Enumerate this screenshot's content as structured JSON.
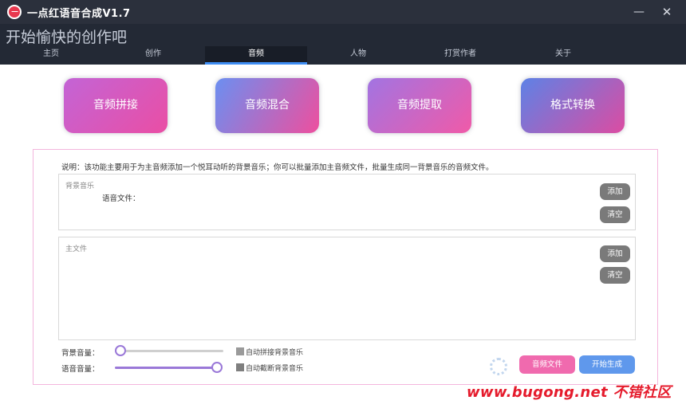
{
  "window": {
    "title": "一点红语音合成V1.7",
    "minimize_glyph": "—",
    "close_glyph": "✕"
  },
  "header": {
    "slogan": "开始愉快的创作吧",
    "tabs": [
      {
        "label": "主页"
      },
      {
        "label": "创作"
      },
      {
        "label": "音频",
        "active": true
      },
      {
        "label": "人物"
      },
      {
        "label": "打赏作者"
      },
      {
        "label": "关于"
      }
    ]
  },
  "features": [
    {
      "label": "音频拼接"
    },
    {
      "label": "音频混合"
    },
    {
      "label": "音频提取"
    },
    {
      "label": "格式转换"
    }
  ],
  "panel": {
    "description": "说明：该功能主要用于为主音频添加一个悦耳动听的背景音乐；你可以批量添加主音频文件，批量生成同一背景音乐的音频文件。",
    "bgm_box": {
      "label": "背景音乐",
      "voice_file_label": "语音文件：",
      "add_label": "添加",
      "clear_label": "清空"
    },
    "main_box": {
      "label": "主文件",
      "add_label": "添加",
      "clear_label": "清空"
    },
    "bg_volume_label": "背景音量：",
    "bg_volume_value": 0,
    "voice_volume_label": "语音音量：",
    "voice_volume_value": 1,
    "auto_concat_label": "自动拼接背景音乐",
    "auto_cut_label": "自动截断背景音乐",
    "audio_file_button": "音频文件",
    "start_button": "开始生成"
  },
  "watermark": "www.bugong.net 不错社区",
  "colors": {
    "titlebar": "#2b303c",
    "header": "#232935",
    "tab_accent": "#3e8df3",
    "panel_border": "#f4b6dd",
    "audio_button": "#f06aae",
    "start_button": "#5f98ec"
  }
}
